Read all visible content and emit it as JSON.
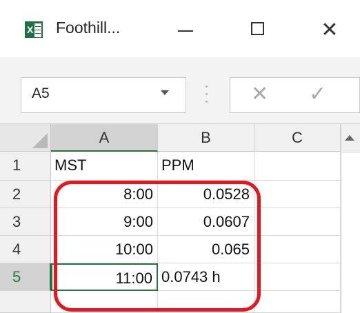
{
  "window": {
    "title": "Foothill...",
    "app_icon": "excel-icon",
    "app_icon_letter": "X",
    "minimize_icon": "minimize-icon",
    "maximize_icon": "maximize-icon",
    "close_glyph": "✕"
  },
  "formula_bar": {
    "name_box": "A5",
    "cancel_glyph": "✕",
    "enter_glyph": "✓",
    "content": ""
  },
  "sheet": {
    "columns": [
      "A",
      "B",
      "C"
    ],
    "rows": [
      {
        "num": "1",
        "a": "MST",
        "b": "PPM",
        "c": ""
      },
      {
        "num": "2",
        "a": "8:00",
        "b": "0.0528",
        "c": ""
      },
      {
        "num": "3",
        "a": "9:00",
        "b": "0.0607",
        "c": ""
      },
      {
        "num": "4",
        "a": "10:00",
        "b": "0.065",
        "c": ""
      },
      {
        "num": "5",
        "a": "11:00",
        "b": "0.0743 h",
        "c": ""
      }
    ],
    "selected_cell": "A5"
  },
  "colors": {
    "excel_green": "#217346",
    "highlight_red": "#e8141e"
  }
}
